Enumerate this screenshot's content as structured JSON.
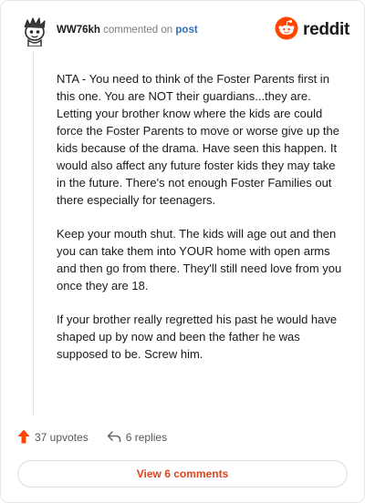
{
  "author": {
    "username": "WW76kh",
    "action_text": "commented on",
    "link_text": "post"
  },
  "brand": {
    "name": "reddit",
    "color": "#ff4500"
  },
  "comment": {
    "paragraphs": [
      "NTA - You need to think of the Foster Parents first in this one. You are NOT their guardians...they are. Letting your brother know where the kids are could force the Foster Parents to move or worse give up the kids because of the drama. Have seen this happen. It would also affect any future foster kids they may take in the future. There's not enough Foster Families out there especially for teenagers.",
      "Keep your mouth shut. The kids will age out and then you can take them into YOUR home with open arms and then go from there. They'll still need love from you once they are 18.",
      "If your brother really regretted his past he would have shaped up by now and been the father he was supposed to be. Screw him."
    ]
  },
  "stats": {
    "upvotes": "37 upvotes",
    "replies": "6 replies"
  },
  "footer": {
    "view_comments": "View 6 comments"
  },
  "icons": {
    "upvote": "upvote-arrow-icon",
    "reply": "reply-arrow-icon",
    "avatar": "snoo-avatar-icon",
    "logo": "reddit-snoo-logo-icon"
  }
}
